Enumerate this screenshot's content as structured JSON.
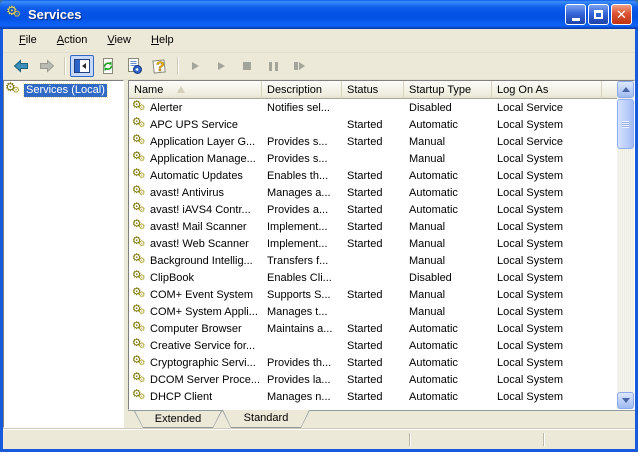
{
  "window": {
    "title": "Services"
  },
  "titlebar": {
    "icon": "services-gears-icon",
    "buttons": {
      "minimize": "minimize",
      "maximize": "maximize",
      "close": "close"
    }
  },
  "menu": {
    "items": [
      {
        "label": "File"
      },
      {
        "label": "Action"
      },
      {
        "label": "View"
      },
      {
        "label": "Help"
      }
    ]
  },
  "toolbar": {
    "icons": [
      "back-icon",
      "forward-icon",
      "show-hide-console-tree-icon",
      "refresh-icon",
      "export-list-icon",
      "help-icon",
      "start-service-icon",
      "resume-service-icon",
      "stop-service-icon",
      "pause-service-icon",
      "restart-service-icon"
    ],
    "pressed": "show-hide-console-tree-icon",
    "disabled": [
      "forward-icon",
      "start-service-icon",
      "resume-service-icon",
      "stop-service-icon",
      "pause-service-icon",
      "restart-service-icon"
    ]
  },
  "sidebar": {
    "items": [
      {
        "label": "Services (Local)",
        "selected": true
      }
    ]
  },
  "table": {
    "columns": [
      "Name",
      "Description",
      "Status",
      "Startup Type",
      "Log On As"
    ],
    "sort": {
      "column": "Name",
      "direction": "ascending"
    },
    "rows": [
      {
        "name": "Alerter",
        "description": "Notifies sel...",
        "status": "",
        "startup_type": "Disabled",
        "log_on_as": "Local Service"
      },
      {
        "name": "APC UPS Service",
        "description": "",
        "status": "Started",
        "startup_type": "Automatic",
        "log_on_as": "Local System"
      },
      {
        "name": "Application Layer G...",
        "description": "Provides s...",
        "status": "Started",
        "startup_type": "Manual",
        "log_on_as": "Local Service"
      },
      {
        "name": "Application Manage...",
        "description": "Provides s...",
        "status": "",
        "startup_type": "Manual",
        "log_on_as": "Local System"
      },
      {
        "name": "Automatic Updates",
        "description": "Enables th...",
        "status": "Started",
        "startup_type": "Automatic",
        "log_on_as": "Local System"
      },
      {
        "name": "avast! Antivirus",
        "description": "Manages a...",
        "status": "Started",
        "startup_type": "Automatic",
        "log_on_as": "Local System"
      },
      {
        "name": "avast! iAVS4 Contr...",
        "description": "Provides a...",
        "status": "Started",
        "startup_type": "Automatic",
        "log_on_as": "Local System"
      },
      {
        "name": "avast! Mail Scanner",
        "description": "Implement...",
        "status": "Started",
        "startup_type": "Manual",
        "log_on_as": "Local System"
      },
      {
        "name": "avast! Web Scanner",
        "description": "Implement...",
        "status": "Started",
        "startup_type": "Manual",
        "log_on_as": "Local System"
      },
      {
        "name": "Background Intellig...",
        "description": "Transfers f...",
        "status": "",
        "startup_type": "Manual",
        "log_on_as": "Local System"
      },
      {
        "name": "ClipBook",
        "description": "Enables Cli...",
        "status": "",
        "startup_type": "Disabled",
        "log_on_as": "Local System"
      },
      {
        "name": "COM+ Event System",
        "description": "Supports S...",
        "status": "Started",
        "startup_type": "Manual",
        "log_on_as": "Local System"
      },
      {
        "name": "COM+ System Appli...",
        "description": "Manages t...",
        "status": "",
        "startup_type": "Manual",
        "log_on_as": "Local System"
      },
      {
        "name": "Computer Browser",
        "description": "Maintains a...",
        "status": "Started",
        "startup_type": "Automatic",
        "log_on_as": "Local System"
      },
      {
        "name": "Creative Service for...",
        "description": "",
        "status": "Started",
        "startup_type": "Automatic",
        "log_on_as": "Local System"
      },
      {
        "name": "Cryptographic Servi...",
        "description": "Provides th...",
        "status": "Started",
        "startup_type": "Automatic",
        "log_on_as": "Local System"
      },
      {
        "name": "DCOM Server Proce...",
        "description": "Provides la...",
        "status": "Started",
        "startup_type": "Automatic",
        "log_on_as": "Local System"
      },
      {
        "name": "DHCP Client",
        "description": "Manages n...",
        "status": "Started",
        "startup_type": "Automatic",
        "log_on_as": "Local System"
      }
    ]
  },
  "tabs": [
    {
      "label": "Extended",
      "active": false
    },
    {
      "label": "Standard",
      "active": true
    }
  ],
  "colors": {
    "titlebar_blue": "#0452E3",
    "window_border_blue": "#155BDB",
    "chrome_beige": "#ECE9D8",
    "selection_blue": "#316AC5",
    "close_button_red": "#DD5434",
    "gear_gold": "#7A7200"
  }
}
